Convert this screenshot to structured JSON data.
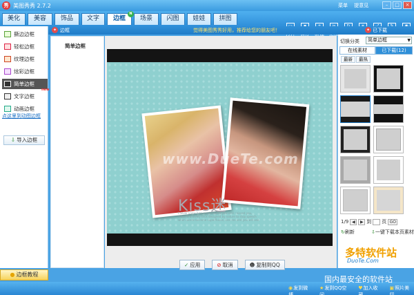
{
  "app": {
    "title": "美图秀秀 2.7.2",
    "logo": "秀"
  },
  "titlebar_links": [
    "菜单",
    "提意见"
  ],
  "window_controls": [
    "minimize",
    "maximize",
    "close"
  ],
  "menu_tabs": [
    {
      "label": "美化",
      "active": false
    },
    {
      "label": "美容",
      "active": false
    },
    {
      "label": "饰品",
      "active": false
    },
    {
      "label": "文字",
      "active": false
    },
    {
      "label": "边框",
      "active": true,
      "badge": "N"
    },
    {
      "label": "场景",
      "active": false
    },
    {
      "label": "闪图",
      "active": false
    },
    {
      "label": "娃娃",
      "active": false
    },
    {
      "label": "拼图",
      "active": false
    }
  ],
  "toolbar": [
    {
      "label": "打开",
      "icon": "open-icon"
    },
    {
      "label": "保存",
      "icon": "save-icon"
    },
    {
      "label": "新建",
      "icon": "new-icon"
    },
    {
      "label": "抠图",
      "icon": "cutout-icon"
    },
    {
      "label": "旋转",
      "icon": "rotate-icon"
    },
    {
      "label": "裁剪",
      "icon": "crop-icon"
    },
    {
      "label": "尺寸",
      "icon": "resize-icon"
    },
    {
      "label": "涂鸦",
      "icon": "doodle-icon"
    },
    {
      "label": "拍照",
      "icon": "camera-icon"
    }
  ],
  "subbar": {
    "left_title": "边框",
    "ad_text": "觉得美图秀秀好用，推荐给您的朋友吧！",
    "right_title": "已下载"
  },
  "left_nav": {
    "items": [
      {
        "label": "撕边边框",
        "active": false
      },
      {
        "label": "轻松边框",
        "active": false
      },
      {
        "label": "纹理边框",
        "active": false
      },
      {
        "label": "炫彩边框",
        "active": false
      },
      {
        "label": "简单边框",
        "active": true
      },
      {
        "label": "文字边框",
        "active": false,
        "badge": "new"
      },
      {
        "label": "动画边框",
        "active": false
      }
    ],
    "link": "点这里到动图边框",
    "import_button": "导入边框",
    "tutorial_button": "边框教程"
  },
  "mid_panel": {
    "title": "简单边框"
  },
  "canvas": {
    "watermark": "www.DueTe.com",
    "kiss_text": "Kiss迷",
    "kiss_subtext": [
      "I never knew how much I loved you until I kissed you,",
      "a kiss is a lovely trick designed by nature to stop speech",
      "when words become superfluous, kiss me and you will see."
    ]
  },
  "action_buttons": [
    {
      "label": "应用",
      "icon": "check-icon"
    },
    {
      "label": "取消",
      "icon": "cancel-icon"
    },
    {
      "label": "复制到QQ",
      "icon": "qq-icon"
    }
  ],
  "right_panel": {
    "category_label": "切换分类",
    "category_value": "简单边框",
    "tabs": [
      "在线素材",
      "已下载(12)"
    ],
    "sort": [
      "最新",
      "最热"
    ],
    "pager": {
      "current": "1/9",
      "goto_label": "到",
      "page_unit": "页",
      "go": "GO"
    },
    "refresh": "刷新",
    "download": "一键下载本页素材"
  },
  "brand": {
    "title": "多特软件站",
    "url": "DuoTe.Com",
    "slogan": "国内最安全的软件站"
  },
  "statusbar": [
    "发到微博",
    "发到QQ空间",
    "加入收藏",
    "照片美印"
  ]
}
